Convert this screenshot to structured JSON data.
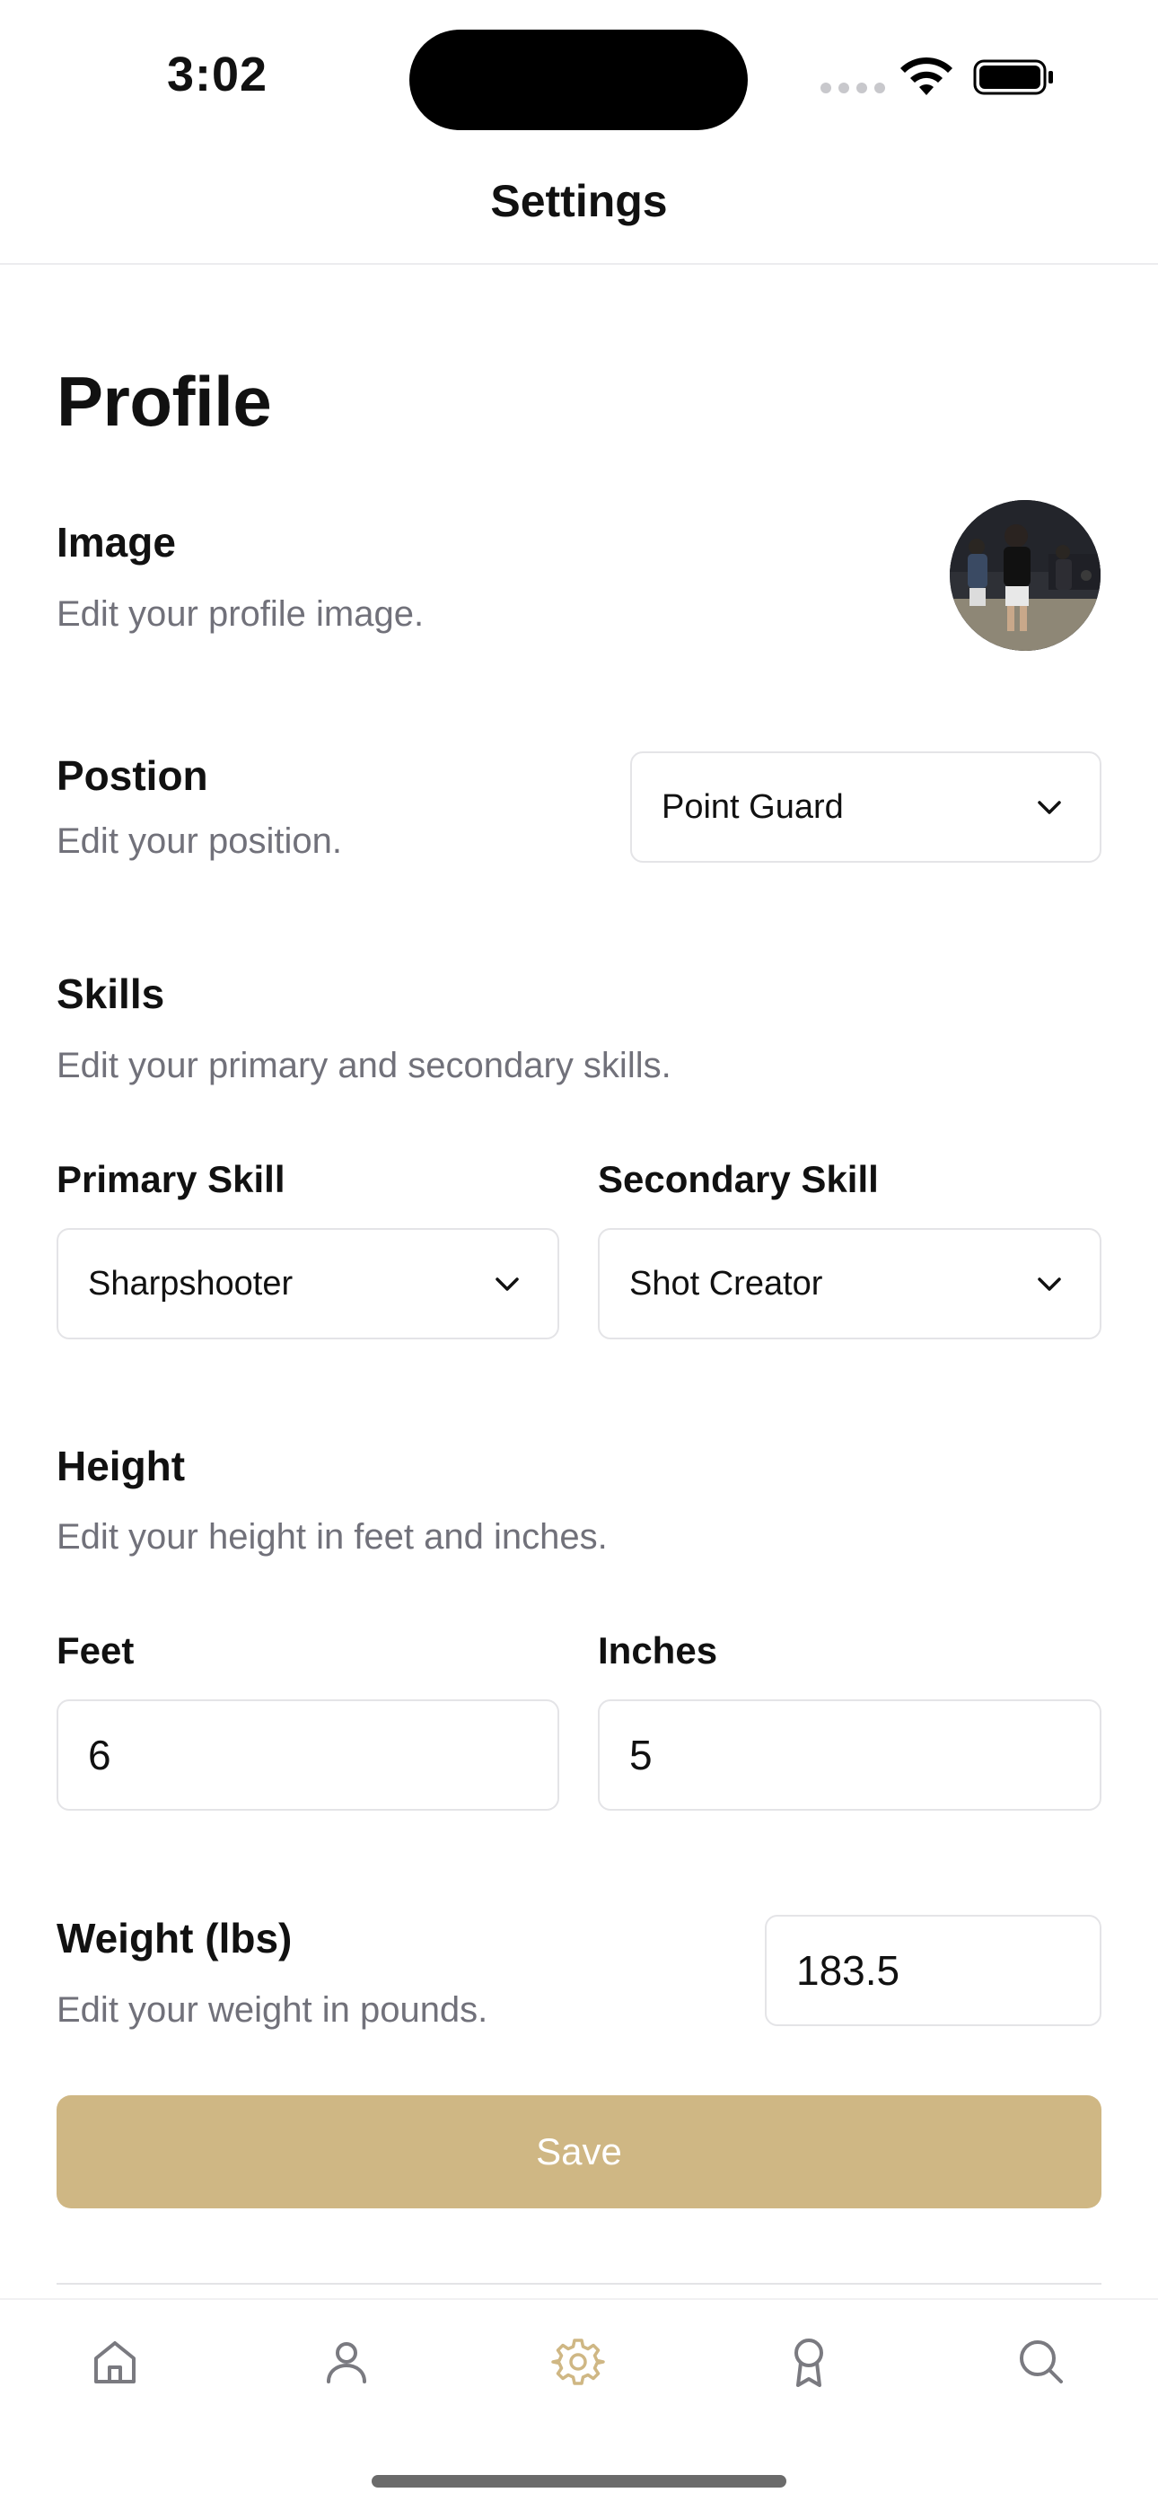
{
  "status_bar": {
    "time": "3:02"
  },
  "nav": {
    "title": "Settings"
  },
  "profile": {
    "title": "Profile",
    "image": {
      "label": "Image",
      "description": "Edit your profile image."
    },
    "position": {
      "label": "Postion",
      "description": "Edit your position.",
      "value": "Point Guard"
    },
    "skills": {
      "label": "Skills",
      "description": "Edit your primary and secondary skills.",
      "primary_label": "Primary Skill",
      "primary_value": "Sharpshooter",
      "secondary_label": "Secondary Skill",
      "secondary_value": "Shot Creator"
    },
    "height": {
      "label": "Height",
      "description": "Edit your height in feet and inches.",
      "feet_label": "Feet",
      "feet_value": "6",
      "inches_label": "Inches",
      "inches_value": "5"
    },
    "weight": {
      "label": "Weight (lbs)",
      "description": "Edit your weight in pounds.",
      "value": "183.5"
    },
    "save_label": "Save"
  },
  "tabbar": {
    "items": [
      {
        "icon": "home-icon",
        "active": false
      },
      {
        "icon": "person-icon",
        "active": false
      },
      {
        "icon": "gear-icon",
        "active": true
      },
      {
        "icon": "award-icon",
        "active": false
      },
      {
        "icon": "search-icon",
        "active": false
      }
    ]
  },
  "colors": {
    "accent": "#cfb784",
    "muted_text": "#71717a",
    "border": "#e4e4e7",
    "tab_inactive": "#7a7a80"
  }
}
